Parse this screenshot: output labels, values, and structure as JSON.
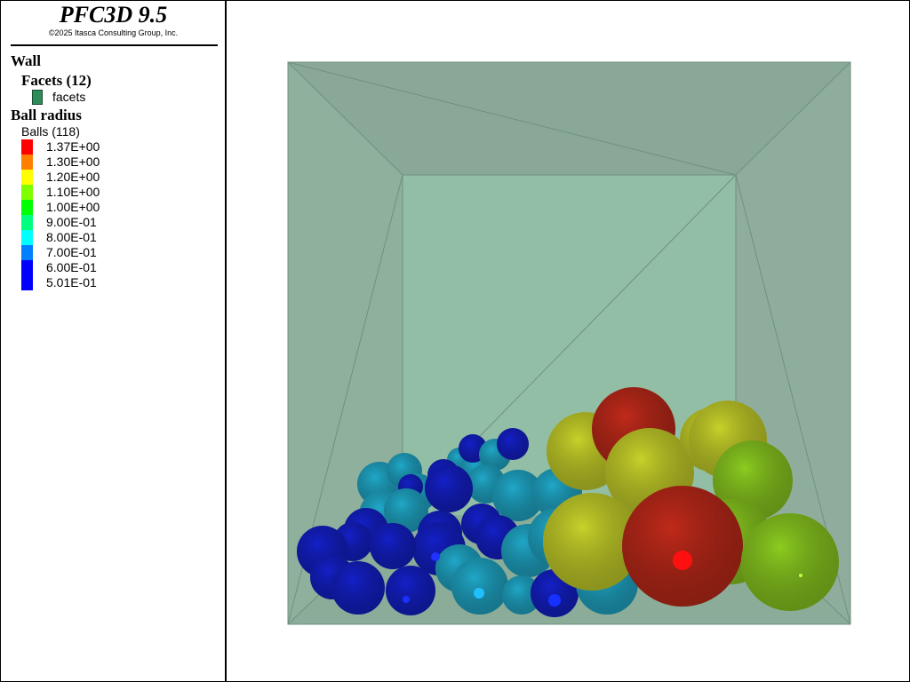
{
  "header": {
    "title": "PFC3D 9.5",
    "copyright": "©2025 Itasca Consulting Group, Inc."
  },
  "legend": {
    "wall_heading": "Wall",
    "facets_heading": "Facets (12)",
    "facets_item": {
      "label": "facets",
      "color": "#2e8b5a"
    },
    "ball_heading": "Ball radius",
    "balls_count_label": "Balls (118)",
    "scale": [
      {
        "label": "1.37E+00",
        "color": "#ff0000"
      },
      {
        "label": "1.30E+00",
        "color": "#ff7f00"
      },
      {
        "label": "1.20E+00",
        "color": "#ffff00"
      },
      {
        "label": "1.10E+00",
        "color": "#7fff00"
      },
      {
        "label": "1.00E+00",
        "color": "#00ff00"
      },
      {
        "label": "9.00E-01",
        "color": "#00ff7f"
      },
      {
        "label": "8.00E-01",
        "color": "#00ffff"
      },
      {
        "label": "7.00E-01",
        "color": "#007fff"
      },
      {
        "label": "6.00E-01",
        "color": "#0000ff"
      },
      {
        "label": "5.01E-01",
        "color": "#0000ff"
      }
    ]
  },
  "colors": {
    "box_back": "#92bea6",
    "box_side": "#8aaa98",
    "edge": "#6f8f7e",
    "ball_blue": "#1420c8",
    "ball_cyan": "#20a8c8",
    "ball_yellow": "#c8d22a",
    "ball_lime": "#8ccc20",
    "ball_red": "#c02a1a"
  }
}
